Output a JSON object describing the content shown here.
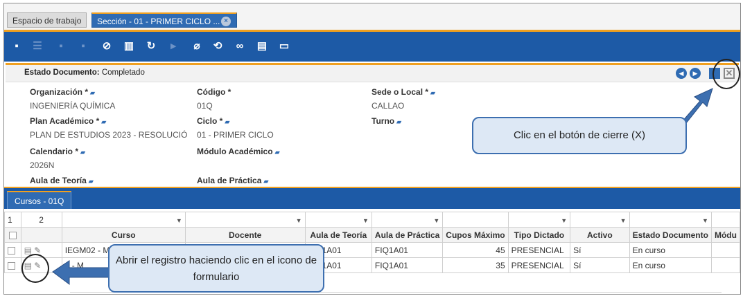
{
  "tabs": [
    {
      "label": "Espacio de trabajo"
    },
    {
      "label": "Sección - 01 - PRIMER CICLO ..."
    }
  ],
  "header": {
    "estado_label": "Estado Documento:",
    "estado_value": "Completado"
  },
  "form": {
    "organizacion": {
      "label": "Organización *",
      "value": "INGENIERÍA QUÍMICA"
    },
    "codigo": {
      "label": "Código *",
      "value": "01Q"
    },
    "sede": {
      "label": "Sede o Local *",
      "value": "CALLAO"
    },
    "plan": {
      "label": "Plan Académico *",
      "value": "PLAN DE ESTUDIOS 2023 - RESOLUCIÓ"
    },
    "ciclo": {
      "label": "Ciclo *",
      "value": "01 - PRIMER CICLO"
    },
    "turno": {
      "label": "Turno",
      "value": ""
    },
    "calendario": {
      "label": "Calendario *",
      "value": "2026N"
    },
    "modulo": {
      "label": "Módulo Académico",
      "value": ""
    },
    "aula_teoria": {
      "label": "Aula de Teoría",
      "value": ""
    },
    "aula_practica": {
      "label": "Aula de Práctica",
      "value": ""
    }
  },
  "callouts": {
    "close": "Clic en el botón de cierre (X)",
    "open": "Abrir el registro haciendo clic en el icono de formulario"
  },
  "grid": {
    "tab_label": "Cursos - 01Q",
    "group_numbers": [
      "1",
      "2"
    ],
    "columns": [
      "Curso",
      "Docente",
      "Aula de Teoría",
      "Aula de Práctica",
      "Cupos Máximo",
      "Tipo Dictado",
      "Activo",
      "Estado Documento",
      "Módu"
    ],
    "rows": [
      {
        "curso": "IEGM02 - M",
        "docente": "",
        "aula_teoria": "FIQ1A01",
        "aula_practica": "FIQ1A01",
        "cupos": "45",
        "tipo": "PRESENCIAL",
        "activo": "Sí",
        "estado": "En curso"
      },
      {
        "curso": "1 - M",
        "docente": "",
        "aula_teoria": "FIQ1A01",
        "aula_practica": "FIQ1A01",
        "cupos": "35",
        "tipo": "PRESENCIAL",
        "activo": "Sí",
        "estado": "En curso"
      }
    ]
  },
  "colors": {
    "toolbar": "#1d5aa6",
    "accent": "#f0a020",
    "callout_bg": "#dde8f5"
  }
}
